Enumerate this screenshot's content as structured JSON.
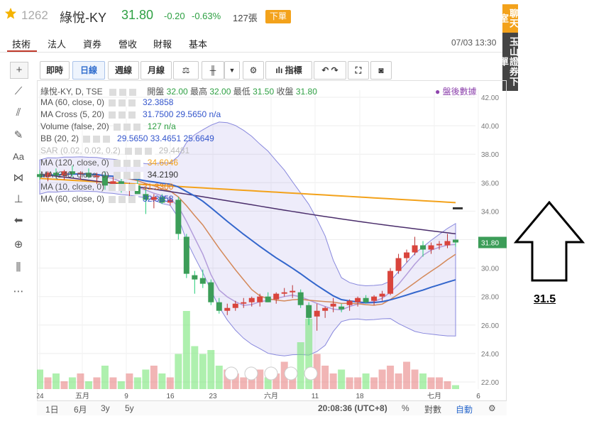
{
  "stock": {
    "code": "1262",
    "name": "綠悅-KY",
    "price": "31.80",
    "change": "-0.20",
    "change_pct": "-0.63%",
    "volume": "127張",
    "order_button": "下單"
  },
  "tabs": [
    "技術",
    "法人",
    "資券",
    "營收",
    "財報",
    "基本"
  ],
  "datetime": "07/03 13:30",
  "side_buttons": {
    "chat": "聊天室",
    "broker": "玉山證券下單"
  },
  "toolbar": {
    "period_buttons": [
      "即時",
      "日線",
      "週線",
      "月線"
    ],
    "indicators_label": "指標"
  },
  "legend": {
    "main": "綠悅-KY, D, TSE",
    "open_label": "開盤",
    "open": "32.00",
    "high_label": "最高",
    "high": "32.00",
    "low_label": "最低",
    "low": "31.50",
    "close_label": "收盤",
    "close": "31.80",
    "after_hours": "盤後數據",
    "lines": [
      {
        "label": "MA (60, close, 0)",
        "value": "32.3858",
        "color": "#3355cc"
      },
      {
        "label": "MA Cross (5, 20)",
        "value": "31.7500  29.5650  n/a",
        "color": "#3355cc"
      },
      {
        "label": "Volume (false, 20)",
        "value": "127  n/a",
        "color": "#2ea043"
      },
      {
        "label": "BB (20, 2)",
        "value": "29.5650  33.4651  25.6649",
        "color": "#3355cc"
      },
      {
        "label": "SAR (0.02, 0.02, 0.2)",
        "value": "29.4481",
        "color": "#bbbbbb"
      },
      {
        "label": "MA (120, close, 0)",
        "value": "34.6046",
        "color": "#f3a21b"
      },
      {
        "label": "MA (240, close, 0)",
        "value": "34.2190",
        "color": "#333333"
      },
      {
        "label": "MA (10, close, 0)",
        "value": "31.3300",
        "color": "#e67e22"
      },
      {
        "label": "MA (60, close, 0)",
        "value": "32.3858",
        "color": "#3355cc"
      }
    ]
  },
  "bottom_bar": {
    "ranges": [
      "1日",
      "6月",
      "3y",
      "5y"
    ],
    "time": "20:08:36 (UTC+8)",
    "percent": "%",
    "log": "對數",
    "auto": "自動"
  },
  "annotation": {
    "value": "31.5"
  },
  "chart_data": {
    "type": "candlestick",
    "y_ticks": [
      "42.00",
      "40.00",
      "38.00",
      "36.00",
      "34.00",
      "32.00",
      "30.00",
      "28.00",
      "26.00",
      "24.00",
      "22.00"
    ],
    "ylim": [
      21.5,
      42.5
    ],
    "x_ticks": [
      "24",
      "五月",
      "9",
      "16",
      "23",
      "六月",
      "11",
      "18",
      "七月",
      "6"
    ],
    "current_price_label": "31.80",
    "candles": [
      {
        "o": 36.6,
        "h": 36.9,
        "l": 36.2,
        "c": 36.4
      },
      {
        "o": 36.4,
        "h": 36.8,
        "l": 36.1,
        "c": 36.7
      },
      {
        "o": 36.7,
        "h": 37.0,
        "l": 36.3,
        "c": 36.5
      },
      {
        "o": 36.5,
        "h": 36.9,
        "l": 36.2,
        "c": 36.8
      },
      {
        "o": 36.8,
        "h": 37.2,
        "l": 36.4,
        "c": 36.6
      },
      {
        "o": 36.6,
        "h": 36.8,
        "l": 36.2,
        "c": 36.7
      },
      {
        "o": 36.7,
        "h": 37.0,
        "l": 36.3,
        "c": 36.4
      },
      {
        "o": 36.4,
        "h": 36.7,
        "l": 35.9,
        "c": 36.5
      },
      {
        "o": 36.5,
        "h": 36.8,
        "l": 35.5,
        "c": 35.8
      },
      {
        "o": 35.8,
        "h": 36.4,
        "l": 35.5,
        "c": 36.1
      },
      {
        "o": 36.1,
        "h": 36.3,
        "l": 35.3,
        "c": 35.5
      },
      {
        "o": 35.5,
        "h": 36.0,
        "l": 35.0,
        "c": 35.8
      },
      {
        "o": 35.8,
        "h": 36.5,
        "l": 35.4,
        "c": 35.2
      },
      {
        "o": 35.2,
        "h": 35.6,
        "l": 33.8,
        "c": 34.8
      },
      {
        "o": 34.8,
        "h": 35.2,
        "l": 34.2,
        "c": 35.0
      },
      {
        "o": 35.0,
        "h": 35.2,
        "l": 34.5,
        "c": 34.6
      },
      {
        "o": 34.6,
        "h": 35.0,
        "l": 34.4,
        "c": 34.8
      },
      {
        "o": 34.8,
        "h": 35.0,
        "l": 32.0,
        "c": 32.4
      },
      {
        "o": 32.2,
        "h": 32.4,
        "l": 29.3,
        "c": 29.6
      },
      {
        "o": 29.5,
        "h": 29.8,
        "l": 28.2,
        "c": 29.2
      },
      {
        "o": 29.3,
        "h": 29.9,
        "l": 28.6,
        "c": 28.9
      },
      {
        "o": 29.0,
        "h": 29.2,
        "l": 27.4,
        "c": 27.6
      },
      {
        "o": 27.6,
        "h": 27.9,
        "l": 26.8,
        "c": 27.0
      },
      {
        "o": 27.0,
        "h": 27.5,
        "l": 26.7,
        "c": 27.2
      },
      {
        "o": 27.2,
        "h": 27.7,
        "l": 27.0,
        "c": 27.5
      },
      {
        "o": 27.5,
        "h": 27.9,
        "l": 27.2,
        "c": 27.6
      },
      {
        "o": 27.6,
        "h": 28.0,
        "l": 27.3,
        "c": 27.9
      },
      {
        "o": 27.6,
        "h": 28.2,
        "l": 27.3,
        "c": 28.0
      },
      {
        "o": 28.0,
        "h": 28.3,
        "l": 27.6,
        "c": 27.6
      },
      {
        "o": 27.8,
        "h": 28.3,
        "l": 27.5,
        "c": 28.2
      },
      {
        "o": 28.2,
        "h": 28.6,
        "l": 28.0,
        "c": 28.3
      },
      {
        "o": 28.3,
        "h": 28.8,
        "l": 27.9,
        "c": 28.4
      },
      {
        "o": 28.3,
        "h": 28.5,
        "l": 27.2,
        "c": 27.4
      },
      {
        "o": 27.4,
        "h": 27.6,
        "l": 26.0,
        "c": 26.5
      },
      {
        "o": 26.6,
        "h": 27.5,
        "l": 25.6,
        "c": 27.0
      },
      {
        "o": 27.0,
        "h": 27.3,
        "l": 26.5,
        "c": 27.2
      },
      {
        "o": 27.3,
        "h": 27.9,
        "l": 26.9,
        "c": 27.5
      },
      {
        "o": 27.3,
        "h": 27.5,
        "l": 26.9,
        "c": 27.1
      },
      {
        "o": 27.4,
        "h": 27.8,
        "l": 27.0,
        "c": 27.7
      },
      {
        "o": 27.6,
        "h": 28.0,
        "l": 27.3,
        "c": 27.9
      },
      {
        "o": 27.9,
        "h": 28.1,
        "l": 27.5,
        "c": 27.6
      },
      {
        "o": 27.7,
        "h": 28.1,
        "l": 27.4,
        "c": 28.0
      },
      {
        "o": 28.0,
        "h": 28.4,
        "l": 27.7,
        "c": 28.2
      },
      {
        "o": 28.2,
        "h": 30.0,
        "l": 28.1,
        "c": 29.8
      },
      {
        "o": 29.8,
        "h": 31.0,
        "l": 29.6,
        "c": 30.7
      },
      {
        "o": 30.7,
        "h": 31.3,
        "l": 30.4,
        "c": 31.1
      },
      {
        "o": 31.1,
        "h": 32.2,
        "l": 30.9,
        "c": 31.6
      },
      {
        "o": 31.6,
        "h": 31.9,
        "l": 30.8,
        "c": 31.3
      },
      {
        "o": 31.3,
        "h": 31.8,
        "l": 31.0,
        "c": 31.6
      },
      {
        "o": 31.6,
        "h": 31.9,
        "l": 31.3,
        "c": 31.7
      },
      {
        "o": 31.6,
        "h": 32.4,
        "l": 31.4,
        "c": 31.9
      },
      {
        "o": 32.0,
        "h": 32.0,
        "l": 31.5,
        "c": 31.8
      }
    ],
    "volumes": [
      5,
      3,
      4,
      2,
      3,
      4,
      2,
      3,
      6,
      3,
      2,
      4,
      3,
      5,
      6,
      4,
      3,
      9,
      20,
      11,
      9,
      10,
      6,
      5,
      4,
      3,
      4,
      5,
      3,
      4,
      7,
      3,
      12,
      18,
      9,
      6,
      4,
      5,
      3,
      3,
      4,
      3,
      5,
      6,
      4,
      7,
      5,
      4,
      3,
      3,
      2,
      1
    ]
  }
}
